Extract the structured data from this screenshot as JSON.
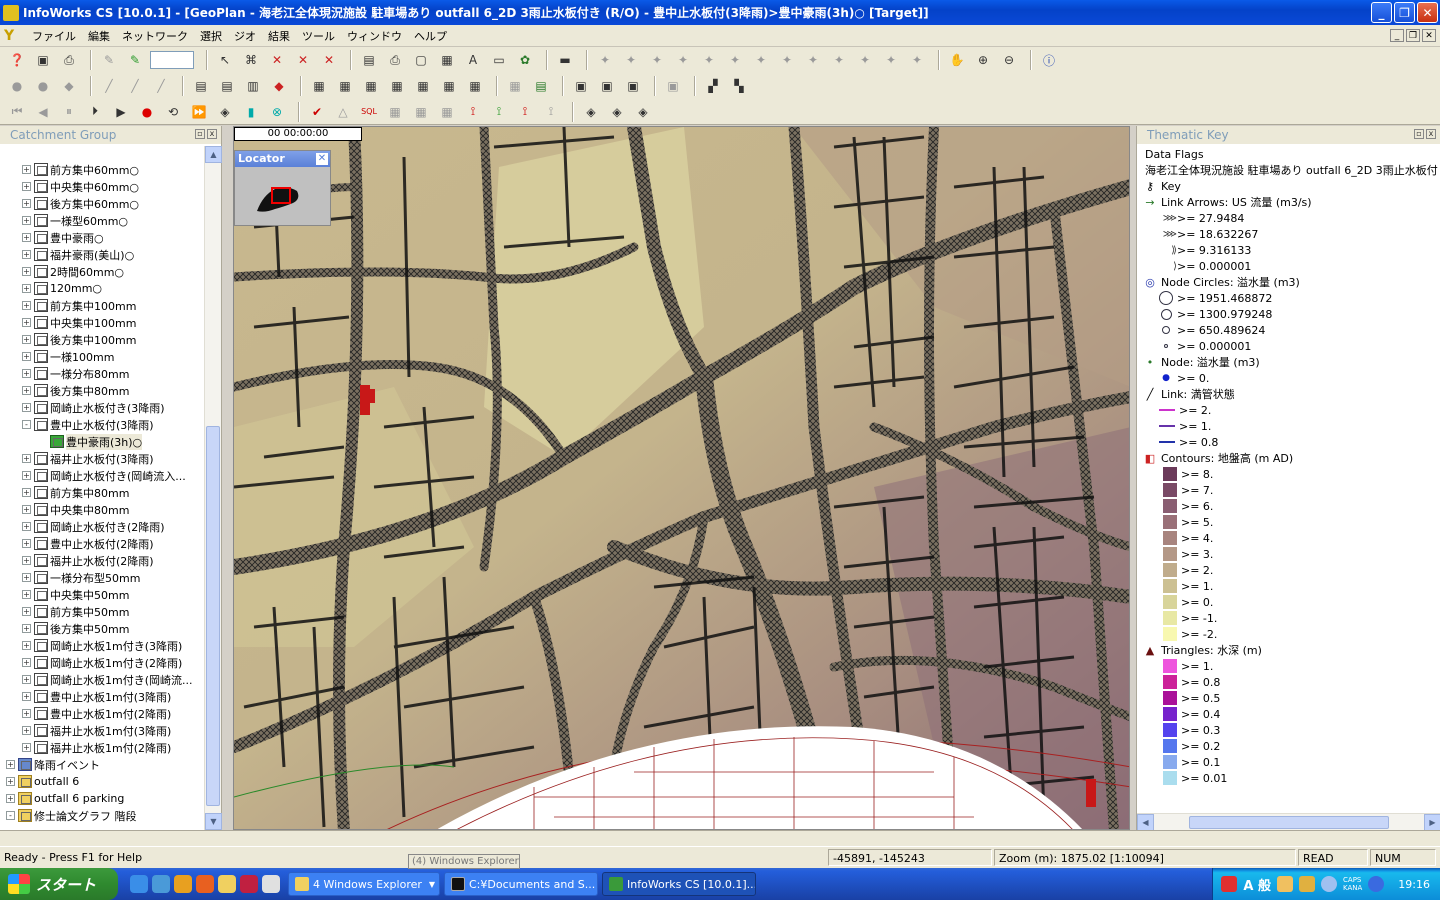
{
  "window": {
    "title": "InfoWorks CS [10.0.1] - [GeoPlan - 海老江全体現況施設  駐車場あり  outfall 6_2D 3雨止水板付き (R/O) - 豊中止水板付(3降雨)>豊中豪雨(3h)○  [Target]]",
    "minimize": "_",
    "restore": "❐",
    "close": "✕"
  },
  "menubar": {
    "items": [
      "ファイル",
      "編集",
      "ネットワーク",
      "選択",
      "ジオ",
      "結果",
      "ツール",
      "ウィンドウ",
      "ヘルプ"
    ],
    "mdi_buttons": [
      "_",
      "❐",
      "✕"
    ]
  },
  "left_panel": {
    "title": "Catchment Group",
    "tree": [
      {
        "label": "前方集中60mm○",
        "expander": "+",
        "icon": "doc"
      },
      {
        "label": "中央集中60mm○",
        "expander": "+",
        "icon": "doc"
      },
      {
        "label": "後方集中60mm○",
        "expander": "+",
        "icon": "doc"
      },
      {
        "label": "一様型60mm○",
        "expander": "+",
        "icon": "doc"
      },
      {
        "label": "豊中豪雨○",
        "expander": "+",
        "icon": "doc"
      },
      {
        "label": "福井豪雨(美山)○",
        "expander": "+",
        "icon": "doc"
      },
      {
        "label": "2時間60mm○",
        "expander": "+",
        "icon": "doc"
      },
      {
        "label": "120mm○",
        "expander": "+",
        "icon": "doc"
      },
      {
        "label": "前方集中100mm",
        "expander": "+",
        "icon": "doc"
      },
      {
        "label": "中央集中100mm",
        "expander": "+",
        "icon": "doc"
      },
      {
        "label": "後方集中100mm",
        "expander": "+",
        "icon": "doc"
      },
      {
        "label": "一様100mm",
        "expander": "+",
        "icon": "doc"
      },
      {
        "label": "一様分布80mm",
        "expander": "+",
        "icon": "doc"
      },
      {
        "label": "後方集中80mm",
        "expander": "+",
        "icon": "doc"
      },
      {
        "label": "岡崎止水板付き(3降雨)",
        "expander": "+",
        "icon": "doc"
      },
      {
        "label": "豊中止水板付(3降雨)",
        "expander": "-",
        "icon": "doc"
      },
      {
        "label": "豊中豪雨(3h)○",
        "expander": "",
        "icon": "green",
        "indent": 1,
        "selected": true
      },
      {
        "label": "福井止水板付(3降雨)",
        "expander": "+",
        "icon": "doc"
      },
      {
        "label": "岡崎止水板付き(岡崎流入...",
        "expander": "+",
        "icon": "doc"
      },
      {
        "label": "前方集中80mm",
        "expander": "+",
        "icon": "doc"
      },
      {
        "label": "中央集中80mm",
        "expander": "+",
        "icon": "doc"
      },
      {
        "label": "岡崎止水板付き(2降雨)",
        "expander": "+",
        "icon": "doc"
      },
      {
        "label": "豊中止水板付(2降雨)",
        "expander": "+",
        "icon": "doc"
      },
      {
        "label": "福井止水板付(2降雨)",
        "expander": "+",
        "icon": "doc"
      },
      {
        "label": "一様分布型50mm",
        "expander": "+",
        "icon": "doc"
      },
      {
        "label": "中央集中50mm",
        "expander": "+",
        "icon": "doc"
      },
      {
        "label": "前方集中50mm",
        "expander": "+",
        "icon": "doc"
      },
      {
        "label": "後方集中50mm",
        "expander": "+",
        "icon": "doc"
      },
      {
        "label": "岡崎止水板1m付き(3降雨)",
        "expander": "+",
        "icon": "doc"
      },
      {
        "label": "岡崎止水板1m付き(2降雨)",
        "expander": "+",
        "icon": "doc"
      },
      {
        "label": "岡崎止水板1m付き(岡崎流...",
        "expander": "+",
        "icon": "doc"
      },
      {
        "label": "豊中止水板1m付(3降雨)",
        "expander": "+",
        "icon": "doc"
      },
      {
        "label": "豊中止水板1m付(2降雨)",
        "expander": "+",
        "icon": "doc"
      },
      {
        "label": "福井止水板1m付(3降雨)",
        "expander": "+",
        "icon": "doc"
      },
      {
        "label": "福井止水板1m付(2降雨)",
        "expander": "+",
        "icon": "doc"
      },
      {
        "label": "降雨イベント",
        "expander": "+",
        "icon": "blue",
        "level": 0
      },
      {
        "label": "outfall 6",
        "expander": "+",
        "icon": "folder",
        "level": 0
      },
      {
        "label": "outfall 6 parking",
        "expander": "+",
        "icon": "folder",
        "level": 0
      },
      {
        "label": "修士論文グラフ 階段",
        "expander": "-",
        "icon": "folder",
        "level": 0
      }
    ]
  },
  "map": {
    "time": "00 00:00:00",
    "locator_title": "Locator",
    "locator_close": "✕"
  },
  "right_panel": {
    "title": "Thematic Key",
    "header1": "Data Flags",
    "header2": "海老江全体現況施設  駐車場あり  outfall 6_2D 3雨止水板付",
    "key_label": "Key",
    "link_arrows": {
      "title": "Link Arrows: US 流量 (m3/s)",
      "items": [
        ">= 27.9484",
        ">= 18.632267",
        ">= 9.316133",
        ">= 0.000001"
      ]
    },
    "node_circles": {
      "title": "Node Circles: 溢水量 (m3)",
      "items": [
        ">= 1951.468872",
        ">= 1300.979248",
        ">= 650.489624",
        ">= 0.000001"
      ]
    },
    "node": {
      "title": "Node: 溢水量 (m3)",
      "items": [
        ">= 0."
      ]
    },
    "link": {
      "title": "Link: 満管状態",
      "items": [
        {
          "label": ">= 2.",
          "color": "#cc33cc"
        },
        {
          "label": ">= 1.",
          "color": "#6633aa"
        },
        {
          "label": ">= 0.8",
          "color": "#2233aa"
        }
      ]
    },
    "contours": {
      "title": "Contours: 地盤高 (m AD)",
      "items": [
        {
          "label": ">= 8.",
          "color": "#6b3a5a"
        },
        {
          "label": ">= 7.",
          "color": "#7a4a66"
        },
        {
          "label": ">= 6.",
          "color": "#8a5e72"
        },
        {
          "label": ">= 5.",
          "color": "#9a7078"
        },
        {
          "label": ">= 4.",
          "color": "#a8847e"
        },
        {
          "label": ">= 3.",
          "color": "#b49886"
        },
        {
          "label": ">= 2.",
          "color": "#c0ac8c"
        },
        {
          "label": ">= 1.",
          "color": "#ccc092"
        },
        {
          "label": ">= 0.",
          "color": "#d8d49a"
        },
        {
          "label": ">= -1.",
          "color": "#e8e8a4"
        },
        {
          "label": ">= -2.",
          "color": "#f8f8b0"
        }
      ]
    },
    "triangles": {
      "title": "Triangles: 水深 (m)",
      "items": [
        {
          "label": ">= 1.",
          "color": "#ee55dd"
        },
        {
          "label": ">= 0.8",
          "color": "#cc2299"
        },
        {
          "label": ">= 0.5",
          "color": "#aa1199"
        },
        {
          "label": ">= 0.4",
          "color": "#7722cc"
        },
        {
          "label": ">= 0.3",
          "color": "#5544ee"
        },
        {
          "label": ">= 0.2",
          "color": "#5577ee"
        },
        {
          "label": ">= 0.1",
          "color": "#88aaee"
        },
        {
          "label": ">= 0.01",
          "color": "#aaddee"
        }
      ]
    }
  },
  "statusbar": {
    "help": "Ready - Press F1 for Help",
    "coords": "-45891, -145243",
    "zoom": "Zoom (m): 1875.02 [1:10094]",
    "read": "READ",
    "num": "NUM",
    "tooltip": "(4) Windows Explorer"
  },
  "taskbar": {
    "start": "スタート",
    "tasks": [
      {
        "label": "4 Windows Explorer",
        "type": "explorer"
      },
      {
        "label": "C:¥Documents and S...",
        "type": "cmd"
      },
      {
        "label": "InfoWorks CS [10.0.1]...",
        "type": "app"
      }
    ],
    "ime": "A 般",
    "caps": "CAPS",
    "kana": "KANA",
    "clock": "19:16"
  }
}
